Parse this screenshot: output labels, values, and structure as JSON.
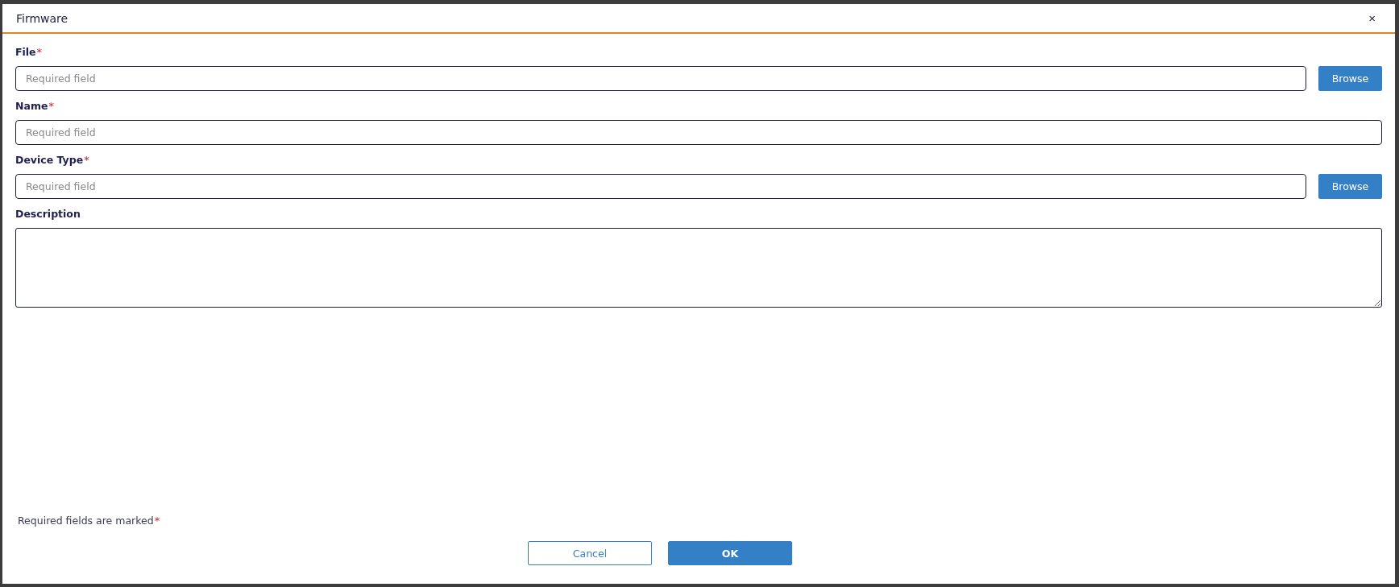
{
  "dialog": {
    "title": "Firmware",
    "close": "×"
  },
  "fields": [
    {
      "kind": "input",
      "label": "File",
      "mark": "*",
      "placeholder": "Required field",
      "button": "Browse"
    },
    {
      "kind": "input",
      "label": "Name",
      "mark": "*",
      "placeholder": "Required field"
    },
    {
      "kind": "input",
      "label": "Device Type",
      "mark": "*",
      "placeholder": "Required field",
      "button": "Browse"
    },
    {
      "kind": "textarea",
      "label": "Description"
    }
  ],
  "note": {
    "text": "Required fields are marked",
    "mark": "*"
  },
  "buttons": [
    {
      "label": "Cancel",
      "kind": "secondary"
    },
    {
      "label": "OK",
      "kind": "primary"
    }
  ]
}
